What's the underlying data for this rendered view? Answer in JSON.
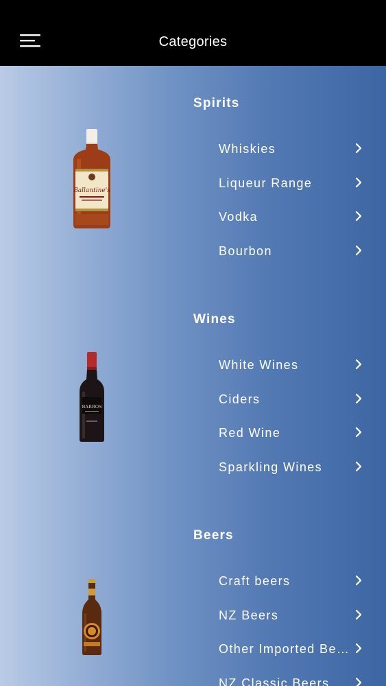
{
  "header": {
    "title": "Categories",
    "menu_icon": "hamburger-menu-icon"
  },
  "sections": [
    {
      "title": "Spirits",
      "image": "whisky-bottle",
      "items": [
        {
          "label": "Whiskies",
          "icon": "chevron-right-icon"
        },
        {
          "label": "Liqueur Range",
          "icon": "chevron-right-icon"
        },
        {
          "label": "Vodka",
          "icon": "chevron-right-icon"
        },
        {
          "label": "Bourbon",
          "icon": "chevron-right-icon"
        }
      ]
    },
    {
      "title": "Wines",
      "image": "wine-bottle",
      "items": [
        {
          "label": "White Wines",
          "icon": "chevron-right-icon"
        },
        {
          "label": "Ciders",
          "icon": "chevron-right-icon"
        },
        {
          "label": "Red Wine",
          "icon": "chevron-right-icon"
        },
        {
          "label": "Sparkling Wines",
          "icon": "chevron-right-icon"
        }
      ]
    },
    {
      "title": "Beers",
      "image": "beer-bottle",
      "items": [
        {
          "label": "Craft beers",
          "icon": "chevron-right-icon"
        },
        {
          "label": "NZ Beers",
          "icon": "chevron-right-icon"
        },
        {
          "label": "Other Imported Beers",
          "icon": "chevron-right-icon"
        },
        {
          "label": "NZ Classic Beers",
          "icon": "chevron-right-icon"
        }
      ]
    }
  ],
  "colors": {
    "header_bg": "#000000",
    "gradient_left": "#b9cbe6",
    "gradient_right": "#3c66a3",
    "text": "#ffffff"
  }
}
